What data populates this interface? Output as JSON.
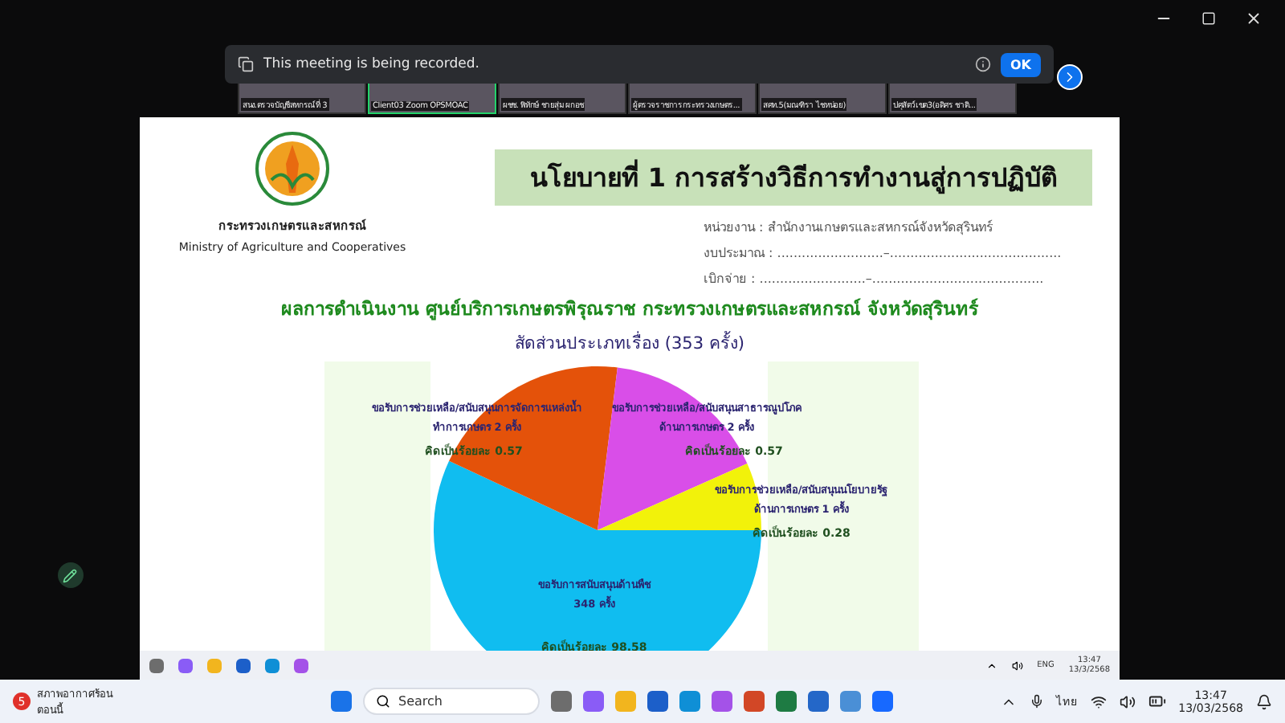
{
  "meeting": {
    "recording_banner": {
      "message": "This meeting is being recorded.",
      "button": "OK"
    },
    "participants": [
      {
        "name": "สนง.ตรวจบัญชีสหกรณ์ที่ 3",
        "speaking": false
      },
      {
        "name": "Client03 Zoom OPSMOAC",
        "speaking": true
      },
      {
        "name": "ผชช. พิทักษ์ ชายสุ่ม ผกอช",
        "speaking": false
      },
      {
        "name": "ผู้ตรวจราชการกระทรวงเกษตร...",
        "speaking": false
      },
      {
        "name": "สศท.5(มณฑิรา ไชหน่อย)",
        "speaking": false
      },
      {
        "name": "ปศุสัตว์เขต3(อดิศร ชาติ...",
        "speaking": false
      }
    ]
  },
  "slide": {
    "ministry_th": "กระทรวงเกษตรและสหกรณ์",
    "ministry_en": "Ministry of Agriculture and Cooperatives",
    "title": "นโยบายที่ 1 การสร้างวิธีการทำงานสู่การปฏิบัติ",
    "info": [
      "หน่วยงาน : สำนักงานเกษตรและสหกรณ์จังหวัดสุรินทร์",
      "งบประมาณ : ..........................–..........................................",
      "เบิกจ่าย : ..........................–.........................................."
    ],
    "headline": "ผลการดำเนินงาน ศูนย์บริการเกษตรพิรุณราช กระทรวงเกษตรและสหกรณ์ จังหวัดสุรินทร์",
    "chart_title": "สัดส่วนประเภทเรื่อง (353 ครั้ง)",
    "slices": [
      {
        "lines": [
          "ขอรับการสนับสนุนด้านพืช",
          "348 ครั้ง"
        ],
        "percent": "คิดเป็นร้อยละ 98.58",
        "color": "#10bdf0"
      },
      {
        "lines": [
          "ขอรับการช่วยเหลือ/สนับสนุนการจัดการแหล่งน้ำ",
          "ทำการเกษตร  2 ครั้ง"
        ],
        "percent": "คิดเป็นร้อยละ 0.57",
        "color": "#e4520a"
      },
      {
        "lines": [
          "ขอรับการช่วยเหลือ/สนับสนุนสาธารณูปโภค",
          "ด้านการเกษตร  2 ครั้ง"
        ],
        "percent": "คิดเป็นร้อยละ 0.57",
        "color": "#d94ee8"
      },
      {
        "lines": [
          "ขอรับการช่วยเหลือ/สนับสนุนนโยบายรัฐ",
          "ด้านการเกษตร  1 ครั้ง"
        ],
        "percent": "คิดเป็นร้อยละ 0.28",
        "color": "#f2f20a"
      }
    ]
  },
  "shared_taskbar": {
    "language": "ENG",
    "time": "13:47",
    "date": "13/3/2568"
  },
  "taskbar": {
    "weather": {
      "badge": "5",
      "condition": "สภาพอากาศร้อน",
      "when": "ตอนนี้"
    },
    "search": {
      "placeholder": "Search"
    },
    "language": "ไทย",
    "time": "13:47",
    "date": "13/03/2568"
  }
}
